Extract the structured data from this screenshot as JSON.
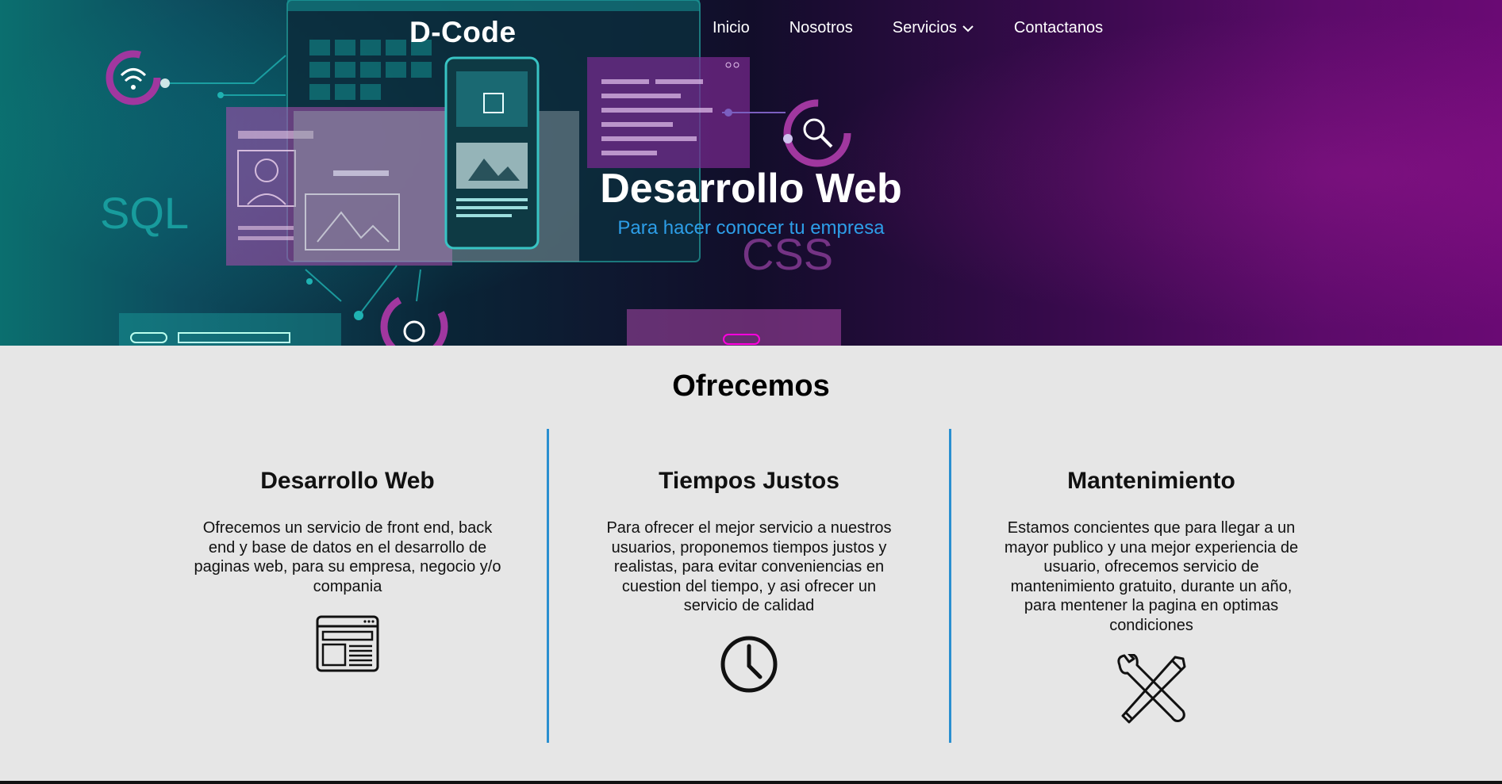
{
  "header": {
    "brand": "D-Code",
    "nav": [
      {
        "label": "Inicio"
      },
      {
        "label": "Nosotros"
      },
      {
        "label": "Servicios",
        "has_dropdown": true
      },
      {
        "label": "Contactanos"
      }
    ]
  },
  "hero": {
    "title": "Desarrollo Web",
    "subtitle": "Para hacer conocer tu empresa",
    "art_labels": {
      "sql": "SQL",
      "css": "CSS"
    }
  },
  "offer": {
    "title": "Ofrecemos",
    "columns": [
      {
        "title": "Desarrollo Web",
        "text": "Ofrecemos un servicio de front end, back end y base de datos en el desarrollo de paginas web, para su empresa, negocio y/o compania",
        "icon": "web-layout-icon"
      },
      {
        "title": "Tiempos Justos",
        "text": "Para ofrecer el mejor servicio a nuestros usuarios, proponemos tiempos justos y realistas, para evitar conveniencias en cuestion del tiempo, y asi ofrecer un servicio de calidad",
        "icon": "clock-icon"
      },
      {
        "title": "Mantenimiento",
        "text": "Estamos concientes que para llegar a un mayor publico y una mejor experiencia de usuario, ofrecemos servicio de mantenimiento gratuito, durante un año, para mentener la pagina en optimas condiciones",
        "icon": "tools-icon"
      }
    ]
  },
  "colors": {
    "accent_blue": "#2a8fd0",
    "subtitle_blue": "#2d9ee8",
    "hero_teal": "#0b6f6f",
    "hero_purple": "#6a0a74",
    "section_bg": "#e6e6e6"
  }
}
